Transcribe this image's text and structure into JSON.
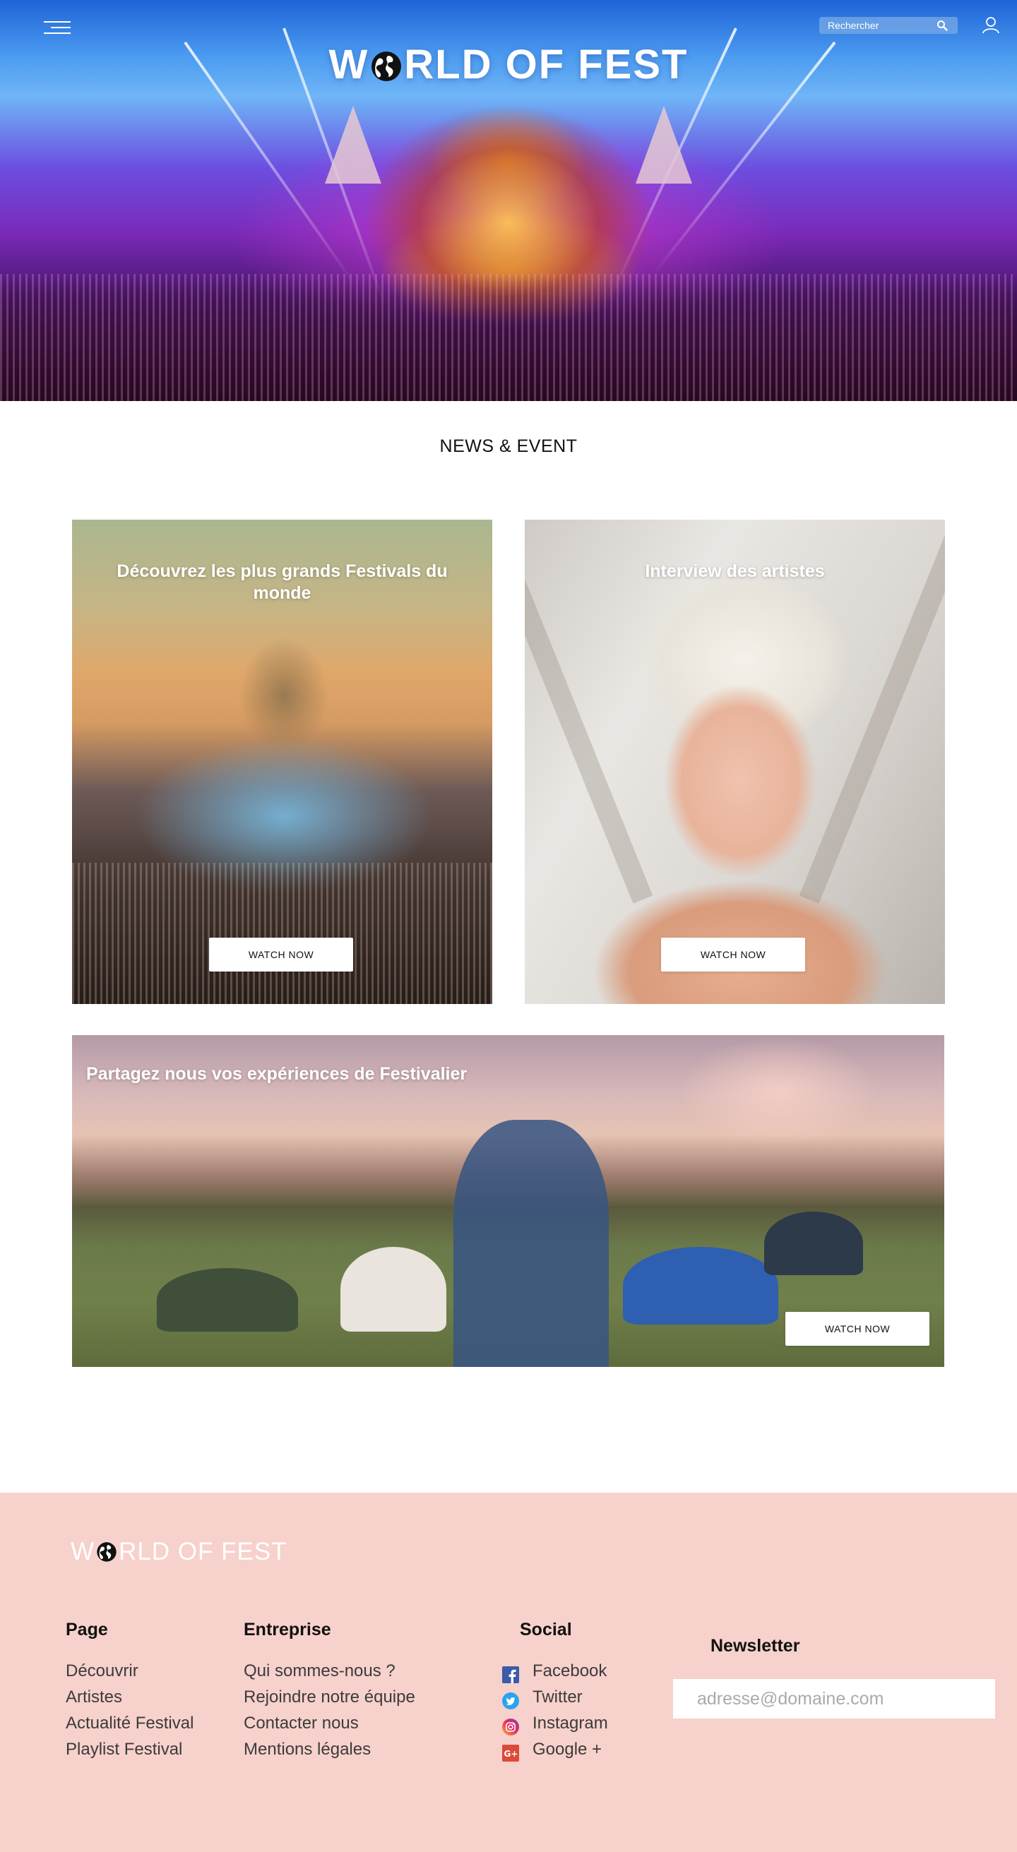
{
  "header": {
    "brand_part1": "W",
    "brand_part2": "RLD OF FEST",
    "search_placeholder": "Rechercher",
    "icons": [
      "menu-icon",
      "search-icon",
      "user-icon",
      "globe-icon"
    ]
  },
  "news": {
    "title": "NEWS & EVENT",
    "cards": [
      {
        "title": "Découvrez les plus grands Festivals du monde",
        "button": "WATCH NOW"
      },
      {
        "title": "Interview des artistes",
        "button": "WATCH NOW"
      },
      {
        "title": "Partagez nous vos expériences de Festivalier",
        "button": "WATCH NOW"
      }
    ]
  },
  "footer": {
    "brand_part1": "W",
    "brand_part2": "RLD OF FEST",
    "page": {
      "title": "Page",
      "links": [
        "Découvrir",
        "Artistes",
        "Actualité Festival",
        "Playlist Festival"
      ]
    },
    "entreprise": {
      "title": "Entreprise",
      "links": [
        "Qui sommes-nous ?",
        "Rejoindre notre équipe",
        "Contacter nous",
        "Mentions légales"
      ]
    },
    "social": {
      "title": "Social",
      "links": [
        "Facebook",
        "Twitter",
        "Instagram",
        "Google +"
      ]
    },
    "newsletter": {
      "title": "Newsletter",
      "placeholder": "adresse@domaine.com"
    }
  },
  "colors": {
    "footer_bg": "#f7d1cb",
    "hero_sky": "#4b9bf0",
    "text": "#111111"
  }
}
